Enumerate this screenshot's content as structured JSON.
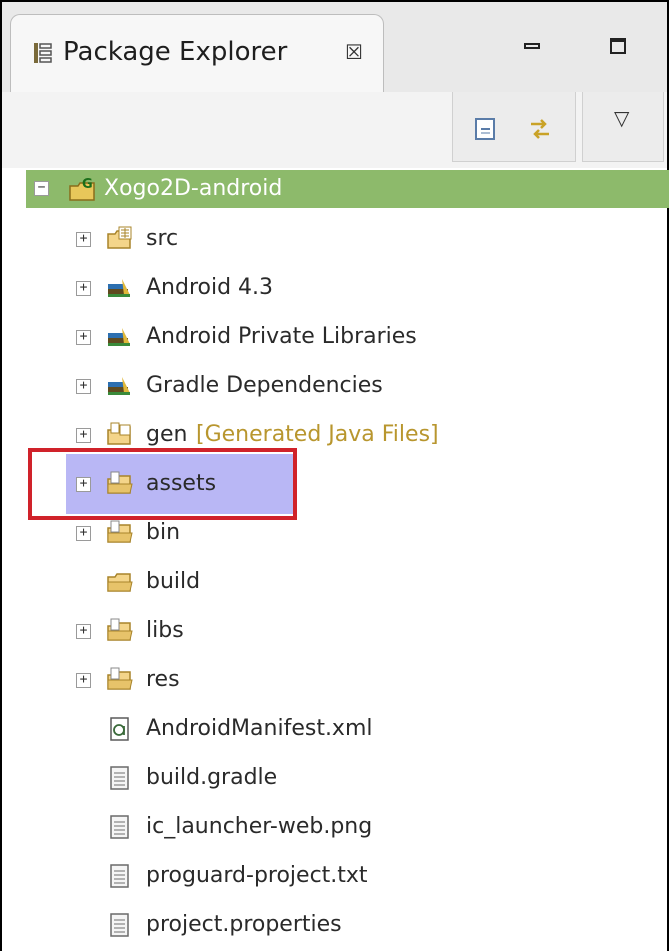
{
  "view": {
    "title": "Package Explorer",
    "close_glyph": "☒",
    "tab_icon": "package-explorer-icon"
  },
  "window_controls": {
    "minimize_icon": "minimize-icon",
    "maximize_icon": "maximize-icon"
  },
  "toolbar": {
    "collapse_all_icon": "collapse-all-icon",
    "link_with_editor_icon": "link-with-editor-icon",
    "view_menu_icon": "view-menu-icon",
    "view_menu_glyph": "▽"
  },
  "tree": {
    "project": {
      "label": "Xogo2D-android",
      "expander": "−",
      "icon": "gradle-project-icon",
      "selected_color": "#8dba6b"
    },
    "items": [
      {
        "label": "src",
        "decoration": "",
        "icon": "source-folder-icon",
        "has_expander": true,
        "expander": "+"
      },
      {
        "label": "Android 4.3",
        "decoration": "",
        "icon": "library-icon",
        "has_expander": true,
        "expander": "+"
      },
      {
        "label": "Android Private Libraries",
        "decoration": "",
        "icon": "library-icon",
        "has_expander": true,
        "expander": "+"
      },
      {
        "label": "Gradle Dependencies",
        "decoration": "",
        "icon": "library-icon",
        "has_expander": true,
        "expander": "+"
      },
      {
        "label": "gen",
        "decoration": "[Generated Java Files]",
        "icon": "generated-source-folder-icon",
        "has_expander": true,
        "expander": "+"
      },
      {
        "label": "assets",
        "decoration": "",
        "icon": "folder-icon",
        "has_expander": true,
        "expander": "+",
        "selected": true
      },
      {
        "label": "bin",
        "decoration": "",
        "icon": "folder-icon",
        "has_expander": true,
        "expander": "+"
      },
      {
        "label": "build",
        "decoration": "",
        "icon": "open-folder-icon",
        "has_expander": false,
        "expander": ""
      },
      {
        "label": "libs",
        "decoration": "",
        "icon": "folder-icon",
        "has_expander": true,
        "expander": "+"
      },
      {
        "label": "res",
        "decoration": "",
        "icon": "folder-icon",
        "has_expander": true,
        "expander": "+"
      },
      {
        "label": "AndroidManifest.xml",
        "decoration": "",
        "icon": "xml-file-icon",
        "has_expander": false,
        "expander": ""
      },
      {
        "label": "build.gradle",
        "decoration": "",
        "icon": "text-file-icon",
        "has_expander": false,
        "expander": ""
      },
      {
        "label": "ic_launcher-web.png",
        "decoration": "",
        "icon": "text-file-icon",
        "has_expander": false,
        "expander": ""
      },
      {
        "label": "proguard-project.txt",
        "decoration": "",
        "icon": "text-file-icon",
        "has_expander": false,
        "expander": ""
      },
      {
        "label": "project.properties",
        "decoration": "",
        "icon": "text-file-icon",
        "has_expander": false,
        "expander": ""
      }
    ]
  },
  "colors": {
    "selection": "#b9b7f5",
    "highlight_border": "#d0222a",
    "decoration_text": "#b8962e"
  }
}
